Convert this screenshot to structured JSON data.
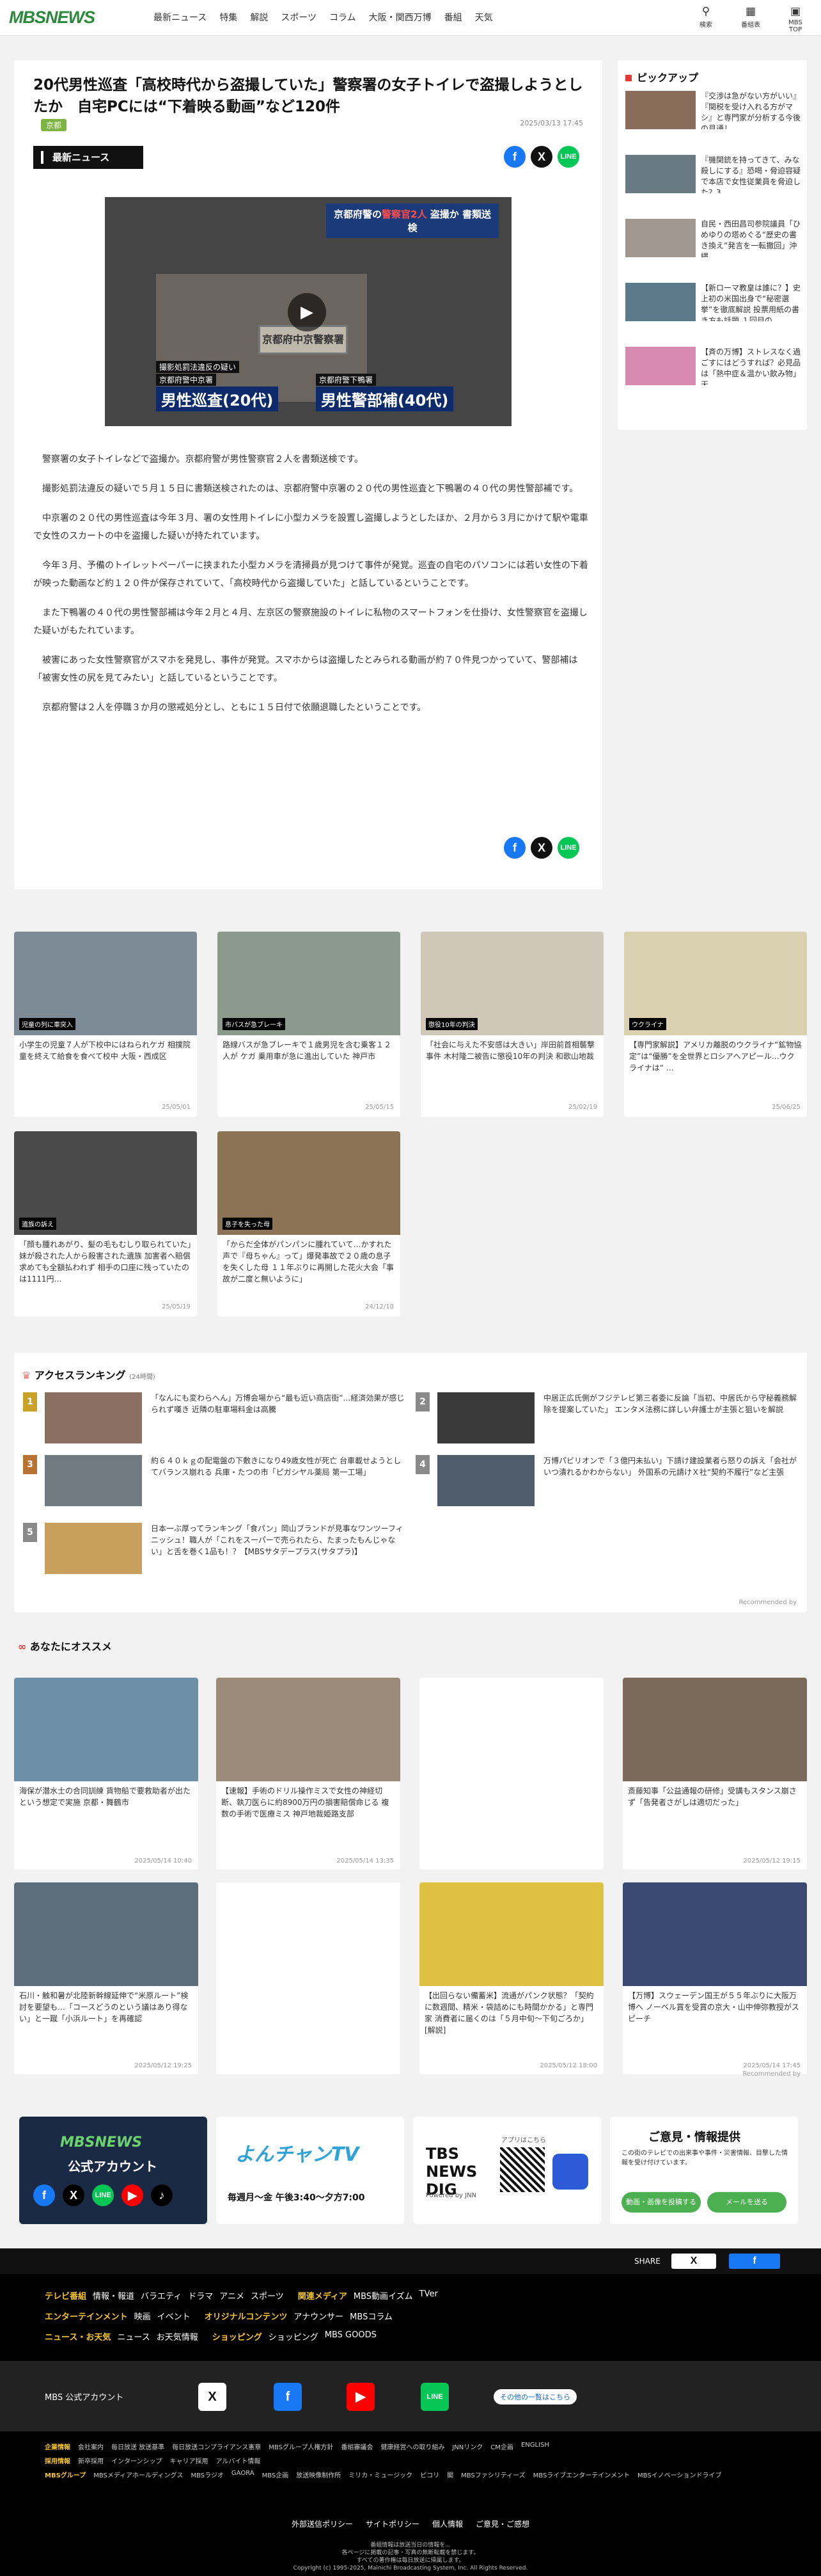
{
  "header": {
    "logo": "MBSNEWS",
    "nav": [
      "最新ニュース",
      "特集",
      "解説",
      "スポーツ",
      "コラム",
      "大阪・関西万博",
      "番組",
      "天気"
    ],
    "icons": [
      {
        "name": "search-icon",
        "label": "検索"
      },
      {
        "name": "bookmark-icon",
        "label": "番組表"
      },
      {
        "name": "tv-icon",
        "label": "MBS TOP"
      }
    ]
  },
  "article": {
    "title": "20代男性巡査「高校時代から盗撮していた」警察署の女子トイレで盗撮しようとしたか　自宅PCには“下着映る動画”など120件",
    "tag": "京都",
    "date": "2025/03/13 17:45",
    "badge": "最新ニュース",
    "video": {
      "caption_pre": "京都府警の",
      "caption_red": "警察官2人",
      "caption_post": "盗撮か 書類送検",
      "sign": "京都府中京警察署",
      "sub_label_left": "撮影処罰法違反の疑い",
      "sub_label_left2": "京都府警中京署",
      "sub_left": "男性巡査(20代)",
      "sub_label_right": "京都府警下鴨署",
      "sub_right": "男性警部補(40代)"
    },
    "paragraphs": [
      "警察署の女子トイレなどで盗撮か。京都府警が男性警察官２人を書類送検です。",
      "撮影処罰法違反の疑いで５月１５日に書類送検されたのは、京都府警中京署の２０代の男性巡査と下鴨署の４０代の男性警部補です。",
      "中京署の２０代の男性巡査は今年３月、署の女性用トイレに小型カメラを設置し盗撮しようとしたほか、２月から３月にかけて駅や電車で女性のスカートの中を盗撮した疑いが持たれています。",
      "今年３月、予備のトイレットペーパーに挟まれた小型カメラを清掃員が見つけて事件が発覚。巡査の自宅のパソコンには若い女性の下着が映った動画など約１２０件が保存されていて、「高校時代から盗撮していた」と話しているということです。",
      "また下鴨署の４０代の男性警部補は今年２月と４月、左京区の警察施設のトイレに私物のスマートフォンを仕掛け、女性警察官を盗撮した疑いがもたれています。",
      "被害にあった女性警察官がスマホを発見し、事件が発覚。スマホからは盗撮したとみられる動画が約７０件見つかっていて、警部補は「被害女性の尻を見てみたい」と話しているということです。",
      "京都府警は２人を停職３か月の懲戒処分とし、ともに１５日付で依願退職したということです。"
    ]
  },
  "pickup": {
    "heading": "ピックアップ",
    "items": [
      "『交渉は急がない方がいい』『関税を受け入れる方がマシ』と専門家が分析する今後の見通し",
      "『機関銃を持ってきて、みな殺しにする』恐喝・脅迫容疑で本店で女性従業員を脅迫した？3…",
      "自民・西田昌司参院議員「ひめゆりの塔めぐる“歴史の書き換え”発言を一転撤回」沖縄…",
      "【新ローマ教皇は誰に？】史上初の米国出身で“秘密選挙”を徹底解説 投票用紙の書き方も話題 １回目の…",
      "【斉の万博】ストレスなく過ごすにはどうすれば？必見品は「熱中症＆温かい飲み物」天…"
    ]
  },
  "related": [
    {
      "text": "小学生の児童７人が下校中にはねられケガ 相撲院童を終えて給食を食べて校中 大阪・西成区",
      "date": "25/05/01",
      "label": "児童の列に車突入"
    },
    {
      "text": "路線バスが急ブレーキで１歳男児を含む乗客１２人が ケガ 乗用車が急に進出していた 神戸市",
      "date": "25/05/15",
      "label": "市バスが急ブレーキ"
    },
    {
      "text": "「社会に与えた不安感は大きい」岸田前首相襲撃事件 木村隆二被告に懲役10年の判決 和歌山地裁",
      "date": "25/02/19",
      "label": "懲役10年の判決"
    },
    {
      "text": "【専門家解説】アメリカ離脱のウクライナ“鉱物協定”は“優勝”を全世界とロシアへアピール…ウクライナは“ …",
      "date": "25/06/25",
      "label": "ウクライナ"
    },
    {
      "text": "「顔も腫れあがり、髪の毛もむしり取られていた」妹が殺された人から殺害された遺族 加害者へ賠償求めても全額払われず 相手の口座に残っていたのは1111円…",
      "date": "25/05/19",
      "label": "遺族の訴え"
    },
    {
      "text": "「からだ全体がパンパンに腫れていて…かすれた声で『母ちゃん』って」爆発事故で２０歳の息子を失くした母 １１年ぶりに再開した花火大会「事故が二度と無いように」",
      "date": "24/12/10",
      "label": "息子を失った母"
    }
  ],
  "ranking": {
    "heading": "アクセスランキング",
    "sub": "(24時間)",
    "items": [
      {
        "no": "1",
        "text": "「なんにも変わらへん」万博会場から“最も近い商店街”…経済効果が感じられず嘆き 近隣の駐車場料金は高騰"
      },
      {
        "no": "2",
        "text": "中居正広氏側がフジテレビ第三者委に反論「当初、中居氏から守秘義務解除を提案していた」 エンタメ法務に詳しい弁護士が主張と狙いを解説"
      },
      {
        "no": "3",
        "text": "約６４０ｋｇの配電盤の下敷きになり49歳女性が死亡 台車載せようとしてバランス崩れる 兵庫・たつの市「ピガシヤル薬局 第一工場」"
      },
      {
        "no": "4",
        "text": "万博パビリオンで「３億円未払い」下請け建設業者ら怒りの訴え「会社がいつ潰れるかわからない」 外国系の元請けＸ社“契約不履行”など主張"
      },
      {
        "no": "5",
        "text": "日本一ぶ厚ってランキング「食パン」岡山ブランドが見事なワンツーフィニッシュ！職人が「これをスーパーで売られたら、たまったもんじゃない」と舌を巻く1品も！？【MBSサタデープラス(サタプラ)】"
      }
    ],
    "footnote": "Recommended by"
  },
  "recommend": {
    "heading": "あなたにオススメ",
    "items": [
      {
        "text": "海保が潜水士の合同訓練 貨物船で要救助者が出たという想定で実施 京都・舞鶴市",
        "date": "2025/05/14 10:40"
      },
      {
        "text": "【速報】手術のドリル操作ミスで女性の神経切断、執刀医らに約8900万円の損害賠償命じる 複数の手術で医療ミス 神戸地裁姫路支部",
        "date": "2025/05/14 13:35"
      },
      {
        "text": "",
        "date": ""
      },
      {
        "text": "斎藤知事「公益通報の研修」受講もスタンス崩さず「告発者さがしは適切だった」",
        "date": "2025/05/12 19:15"
      },
      {
        "text": "石川・触和暑が北陸新幹線延伸で“米原ルート”検討を要望も…「コースどうのという議はあり得ない」と一蹴「小浜ルート」を再確認",
        "date": "2025/05/12 19:25"
      },
      {
        "text": "",
        "date": ""
      },
      {
        "text": "【出回らない備蓄米】流通がパンク状態？「契約に数週間、精米・袋詰めにも時間かかる」と専門家 消費者に届くのは「５月中旬〜下旬ごろか」[解説]",
        "date": "2025/05/12 18:00"
      },
      {
        "text": "【万博】スウェーデン国王が５５年ぶりに大阪万博へ ノーベル賞を受賞の京大・山中伸弥教授がスピーチ",
        "date": "2025/05/14 17:45"
      }
    ],
    "footnote": "Recommended by"
  },
  "banners": {
    "b1_title": "MBSNEWS",
    "b1_sub": "公式アカウント",
    "b2_title": "よんチャンTV",
    "b2_time": "毎週月〜金 午後3:40〜夕方7:00",
    "b3_title": "TBS NEWS DIG",
    "b3_sub": "Powered by JNN",
    "b3_app": "アプリはこちら",
    "b4_title": "ご意見・情報提供",
    "b4_text": "この街のテレビでの出来事や事件・災害情報、目撃した情報を受け付けています。",
    "b4_btn1": "動画・画像を投稿する",
    "b4_btn2": "メールを送る"
  },
  "footer": {
    "share": "SHARE",
    "row1_label": "テレビ番組",
    "row1_items": [
      "情報・報道",
      "バラエティ",
      "ドラマ",
      "アニメ",
      "スポーツ"
    ],
    "row1_label2": "関連メディア",
    "row1_items2": [
      "MBS動画イズム",
      "TVer"
    ],
    "row2_label": "エンターテインメント",
    "row2_items": [
      "映画",
      "イベント"
    ],
    "row2_label2": "オリジナルコンテンツ",
    "row2_items2": [
      "アナウンサー",
      "MBSコラム"
    ],
    "row3_label": "ニュース・お天気",
    "row3_items": [
      "ニュース",
      "お天気情報"
    ],
    "row3_label2": "ショッピング",
    "row3_items2": [
      "ショッピング",
      "MBS GOODS"
    ],
    "official": "MBS 公式アカウント",
    "official_more": "その他の一覧はこちら",
    "corp_label": "企業情報",
    "corp_items": [
      "会社案内",
      "毎日放送 放送基準",
      "毎日放送コンプライアンス憲章",
      "MBSグループ人権方針",
      "番組審議会",
      "健康経営への取り組み",
      "JNNリンク",
      "CM企画",
      "ENGLISH"
    ],
    "recruit_label": "採用情報",
    "recruit_items": [
      "新卒採用",
      "インターンシップ",
      "キャリア採用",
      "アルバイト情報"
    ],
    "group_label": "MBSグループ",
    "group_items": [
      "MBSメディアホールディングス",
      "MBSラジオ",
      "GAORA",
      "MBS企画",
      "放送映像制作所",
      "ミリカ・ミュージック",
      "ピコリ",
      "閣",
      "MBSファシリティーズ",
      "MBSライブエンターテインメント",
      "MBSイノベーションドライブ"
    ],
    "bottom_links": [
      "外部送信ポリシー",
      "サイトポリシー",
      "個人情報",
      "ご意見・ご感想"
    ],
    "notice1": "番組情報は放送当日の情報を...",
    "notice2": "各ページに掲載の記事・写真の無断転載を禁じます。",
    "notice3": "すべての著作権は毎日放送に帰属します。",
    "copyright": "Copyright (c) 1995-2025, Mainichi Broadcasting System, Inc. All Rights Reserved."
  }
}
